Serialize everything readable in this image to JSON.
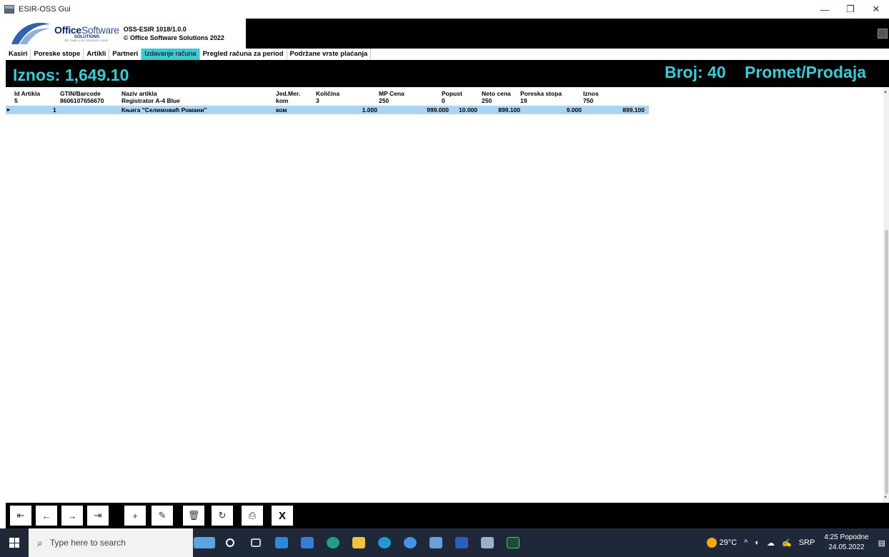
{
  "window": {
    "title": "ESIR-OSS Gui"
  },
  "logo": {
    "brand_bold": "Office",
    "brand_light": "Software",
    "sub": "SOLUTIONS",
    "tagline": "We make your business easier"
  },
  "version": {
    "line1": "OSS-ESIR 1018/1.0.0",
    "line2": "© Office Software Solutions 2022"
  },
  "tabs": [
    {
      "label": "Kasiri"
    },
    {
      "label": "Poreske stope"
    },
    {
      "label": "Artikli"
    },
    {
      "label": "Partneri"
    },
    {
      "label": "Izdavanje računa",
      "active": true
    },
    {
      "label": "Pregled računa za period"
    },
    {
      "label": "Podržane vrste plaćanja"
    }
  ],
  "totals": {
    "iznos": "Iznos: 1,649.10",
    "broj": "Broj: 40",
    "promet": "Promet/Prodaja"
  },
  "table": {
    "columns": [
      "Id Artikla",
      "GTIN/Barcode",
      "Naziv artikla",
      "Jed.Mer.",
      "Količina",
      "MP Cena",
      "Popust",
      "Neto cena",
      "Poreska stopa",
      "Iznos"
    ],
    "rows": [
      [
        "5",
        "8606107656670",
        "Registrator A-4 Blue",
        "kom",
        "3",
        "250",
        "0",
        "250",
        "19",
        "750"
      ],
      [
        "1",
        "",
        "Књига \"Селимовић Романи\"",
        "ком",
        "1.000",
        "999.000",
        "10.000",
        "899.100",
        "9.000",
        "899.100"
      ]
    ]
  },
  "toolbar": {
    "first": "⇤",
    "prev": "←",
    "next": "→",
    "last": "⇥",
    "add": "+",
    "edit": "✎",
    "delete": "🗑",
    "refresh": "↻",
    "print": "⎙",
    "close": "X"
  },
  "taskbar": {
    "search_placeholder": "Type here to search",
    "weather": "29°C",
    "lang": "SRP",
    "time": "4:25 Popodne",
    "date": "24.05.2022"
  },
  "colors": {
    "accent": "#3dc9d6",
    "selected_row": "#a9d4f5",
    "header_bg": "#000000"
  }
}
